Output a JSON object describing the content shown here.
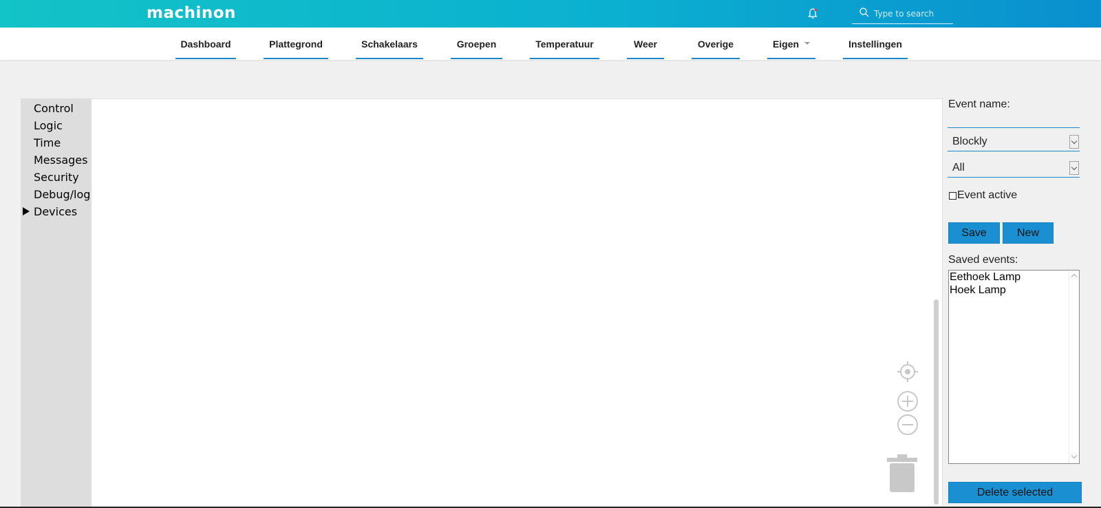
{
  "header": {
    "logo": "machinon",
    "search_placeholder": "Type to search",
    "colors": {
      "gradient_start": "#12c3c7",
      "gradient_end": "#0a8fcf"
    }
  },
  "nav": {
    "items": [
      {
        "label": "Dashboard"
      },
      {
        "label": "Plattegrond"
      },
      {
        "label": "Schakelaars"
      },
      {
        "label": "Groepen"
      },
      {
        "label": "Temperatuur"
      },
      {
        "label": "Weer"
      },
      {
        "label": "Overige"
      },
      {
        "label": "Eigen"
      },
      {
        "label": "Instellingen"
      }
    ],
    "accent_color": "#1a87c9"
  },
  "toolbox": {
    "categories": [
      {
        "label": "Control"
      },
      {
        "label": "Logic"
      },
      {
        "label": "Time"
      },
      {
        "label": "Messages"
      },
      {
        "label": "Security"
      },
      {
        "label": "Debug/log"
      },
      {
        "label": "Devices"
      }
    ]
  },
  "workspace": {
    "icons": [
      "recenter-icon",
      "zoom-in-icon",
      "zoom-out-icon",
      "trash-icon"
    ]
  },
  "panel": {
    "event_name_label": "Event name:",
    "event_name_value": "",
    "type_select": "Blockly",
    "trigger_select": "All",
    "event_active_label": "Event active",
    "event_active_checked": false,
    "save_label": "Save",
    "new_label": "New",
    "saved_events_label": "Saved events:",
    "saved_events": [
      "Eethoek Lamp",
      "Hoek Lamp"
    ],
    "delete_label": "Delete selected",
    "button_color": "#1a8fd2"
  }
}
